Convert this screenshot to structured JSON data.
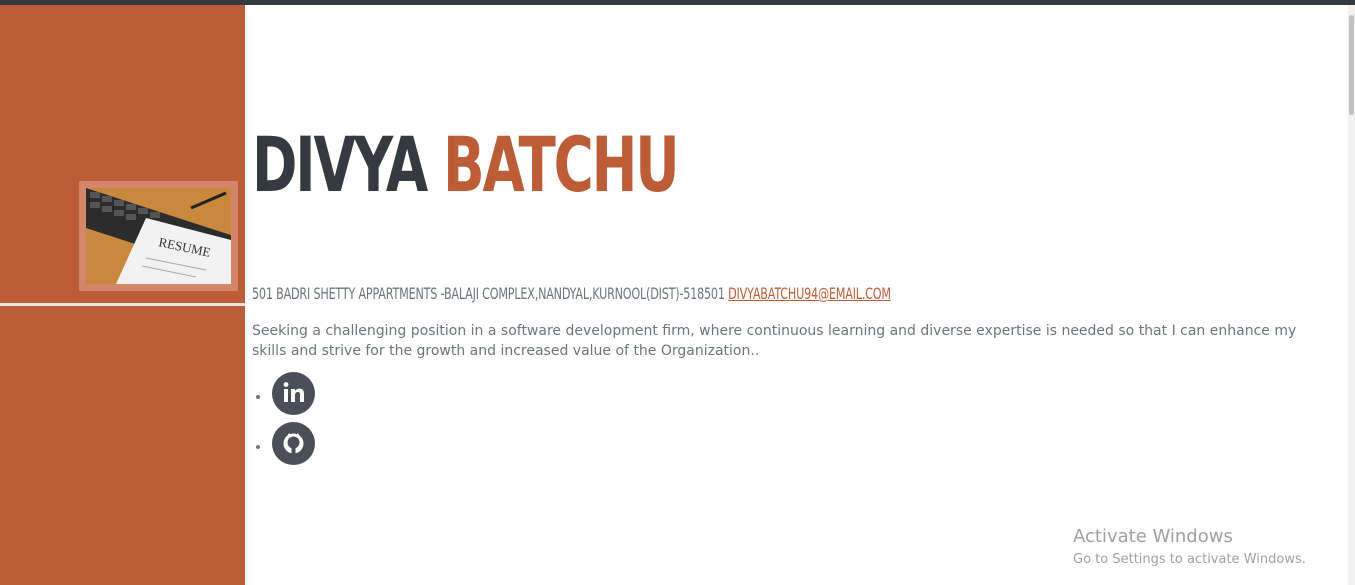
{
  "header": {
    "first_name": "DIVYA",
    "last_name": "BATCHU"
  },
  "contact": {
    "address": "501 BADRI SHETTY APPARTMENTS -BALAJI COMPLEX,NANDYAL,KURNOOL(DIST)-518501",
    "email": "DIVYABATCHU94@EMAIL.COM"
  },
  "objective": "Seeking a challenging position in a software development firm, where continuous learning and diverse expertise is needed so that I can enhance my skills and strive for the growth and increased value of the Organization..",
  "social": {
    "items": [
      {
        "icon": "linkedin-icon"
      },
      {
        "icon": "github-icon"
      }
    ]
  },
  "watermark": {
    "title": "Activate Windows",
    "subtitle": "Go to Settings to activate Windows."
  },
  "colors": {
    "accent": "#bd5d38",
    "dark": "#343a40",
    "muted": "#6c757d"
  }
}
